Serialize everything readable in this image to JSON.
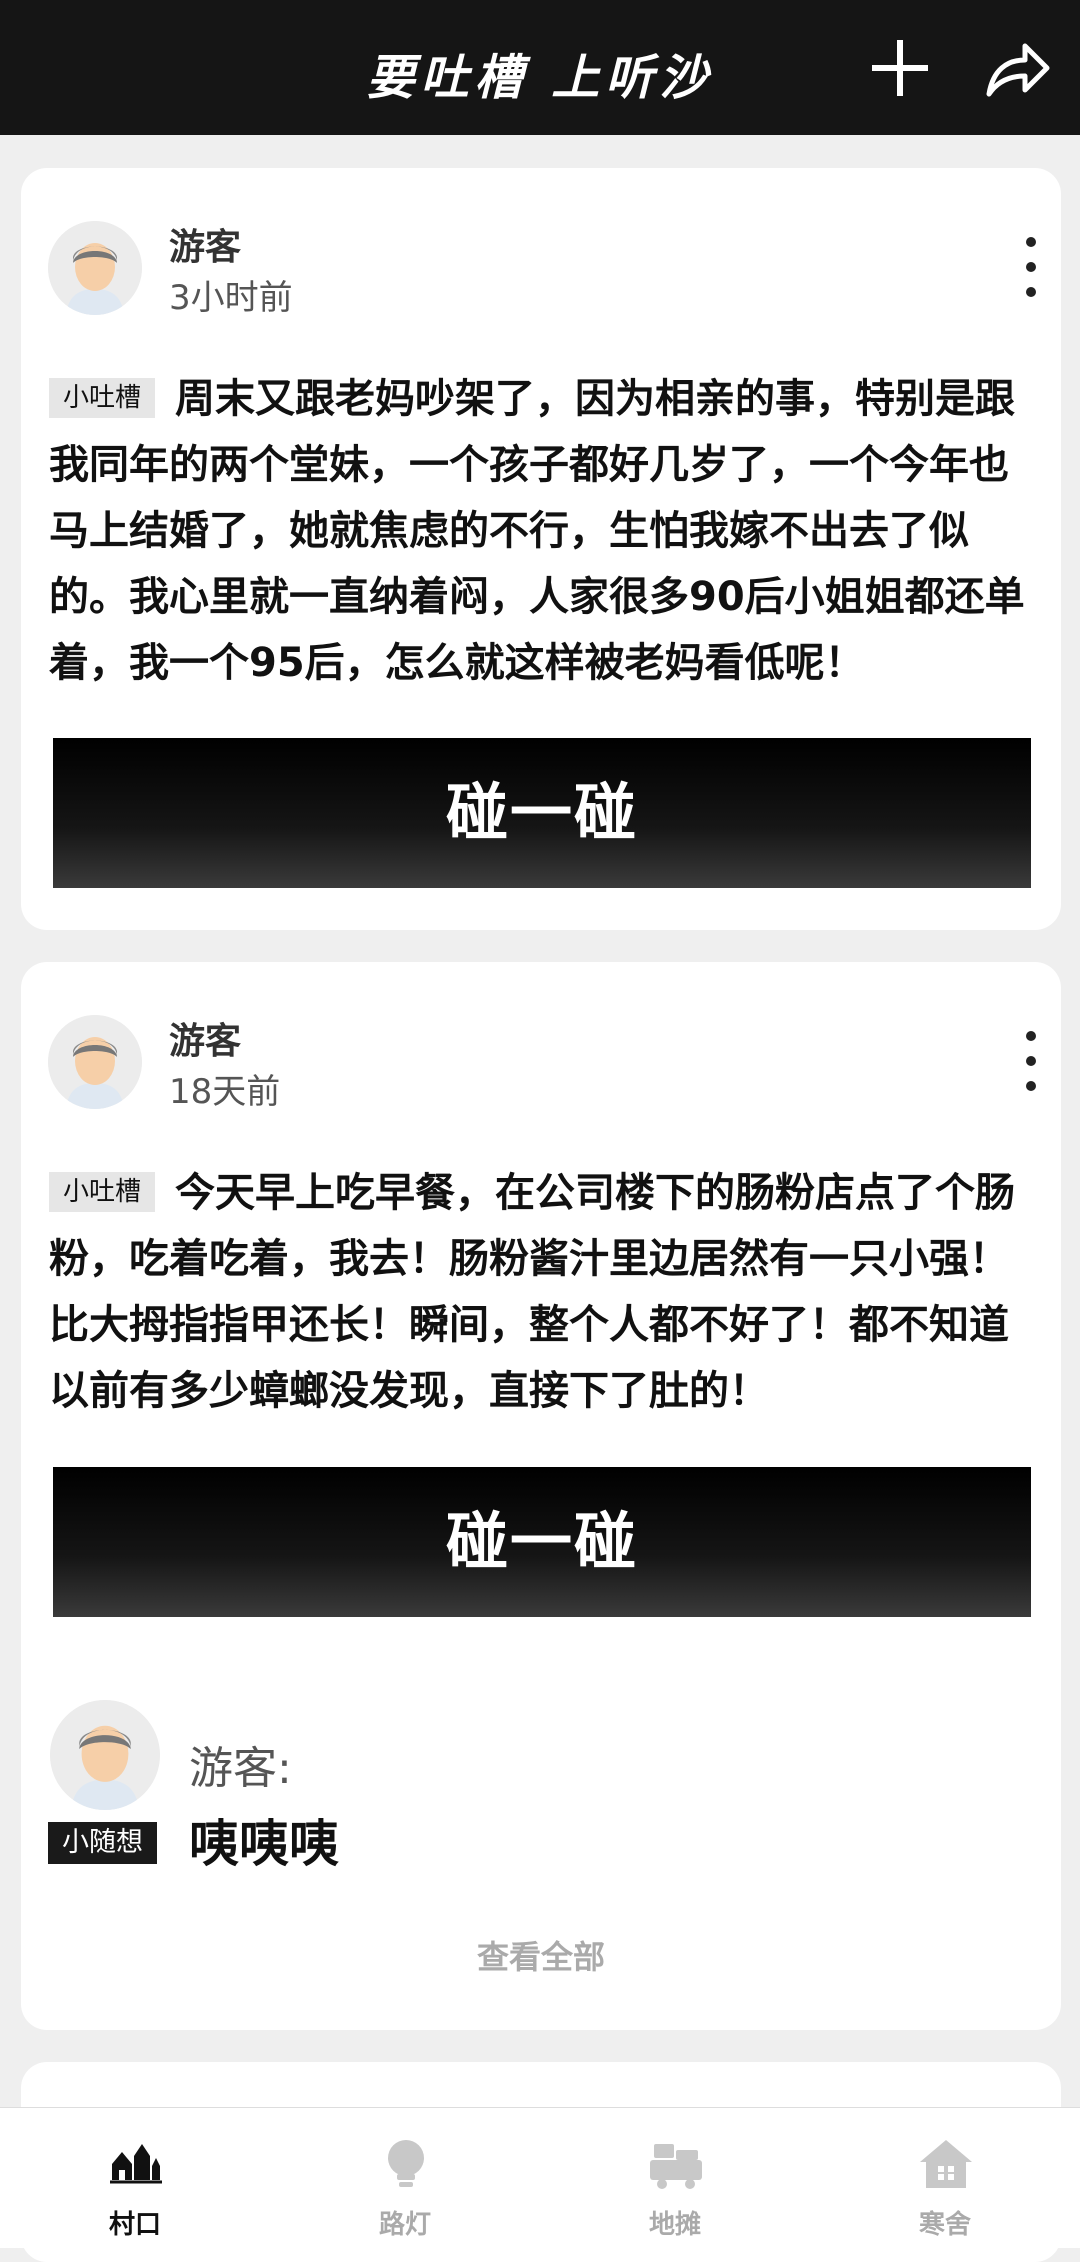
{
  "header": {
    "title": "要吐槽 上听沙"
  },
  "posts": [
    {
      "user": "游客",
      "time": "3小时前",
      "tag": "小吐槽",
      "content": "周末又跟老妈吵架了，因为相亲的事，特别是跟我同年的两个堂妹，一个孩子都好几岁了，一个今年也马上结婚了，她就焦虑的不行，生怕我嫁不出去了似的。我心里就一直纳着闷，人家很多90后小姐姐都还单着，我一个95后，怎么就这样被老妈看低呢！",
      "button": "碰一碰"
    },
    {
      "user": "游客",
      "time": "18天前",
      "tag": "小吐槽",
      "content": "今天早上吃早餐，在公司楼下的肠粉店点了个肠粉，吃着吃着，我去！肠粉酱汁里边居然有一只小强！比大拇指指甲还长！瞬间，整个人都不好了！都不知道以前有多少蟑螂没发现，直接下了肚的！",
      "button": "碰一碰",
      "comment": {
        "name": "游客:",
        "tag": "小随想",
        "text": "咦咦咦"
      },
      "view_all": "查看全部"
    }
  ],
  "nav": [
    {
      "label": "村口",
      "icon": "village-icon",
      "active": true
    },
    {
      "label": "路灯",
      "icon": "lightbulb-icon",
      "active": false
    },
    {
      "label": "地摊",
      "icon": "stall-cart-icon",
      "active": false
    },
    {
      "label": "寒舍",
      "icon": "home-icon",
      "active": false
    }
  ]
}
